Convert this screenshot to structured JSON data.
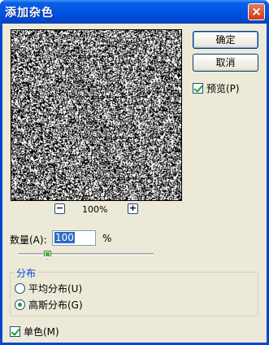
{
  "window": {
    "title": "添加杂色",
    "close_glyph": "×"
  },
  "preview": {
    "zoom_out_glyph": "−",
    "zoom_in_glyph": "+",
    "zoom_level": "100%"
  },
  "buttons": {
    "ok": "确定",
    "cancel": "取消"
  },
  "preview_toggle": {
    "label": "预览(P)",
    "checked": true
  },
  "amount": {
    "label": "数量(A):",
    "value": "100",
    "unit": "%",
    "slider_fraction": 0.2
  },
  "distribution": {
    "group_label": "分布",
    "uniform_label": "平均分布(U)",
    "gaussian_label": "高斯分布(G)",
    "selected": "gaussian"
  },
  "monochromatic": {
    "label": "单色(M)",
    "checked": true
  },
  "colors": {
    "title_bar": "#0054e3",
    "dialog_bg": "#ece9d8",
    "accent_text": "#0046d5",
    "selection": "#316ac5"
  }
}
